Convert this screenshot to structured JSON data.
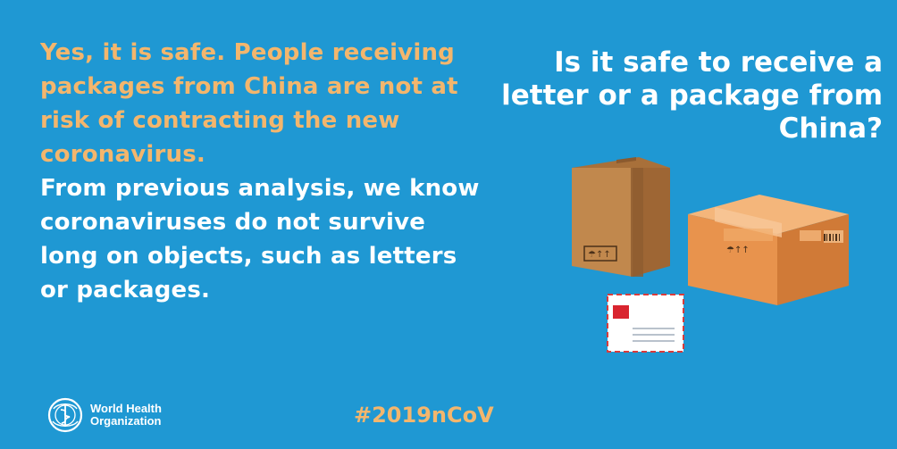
{
  "colors": {
    "background": "#1f98d3",
    "answer_highlight": "#f3b66d",
    "text": "#ffffff",
    "box_brown": "#c1884d",
    "box_orange": "#e8934d"
  },
  "answer": {
    "highlight": "Yes, it is safe. People receiving packages from China are not at risk of contracting the new coronavirus.",
    "detail": "From previous analysis, we know coronaviruses do not survive long on objects, such as letters or packages."
  },
  "question": "Is it safe to receive a letter or a package from China?",
  "illustration": {
    "icons": [
      "tall-box-icon",
      "wide-box-icon",
      "envelope-icon"
    ]
  },
  "footer": {
    "org_name_line1": "World Health",
    "org_name_line2": "Organization",
    "hashtag": "#2019nCoV"
  }
}
